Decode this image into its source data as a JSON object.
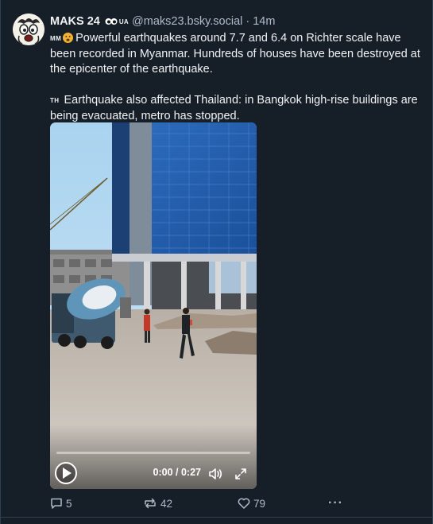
{
  "post": {
    "author_name": "MAKS 24",
    "badge_code": "UA",
    "handle": "@maks23.bsky.social",
    "separator": "·",
    "time": "14m",
    "p1_flag": "MM",
    "p1_text": "Powerful earthquakes around 7.7 and 6.4 on Richter scale have been recorded in Myanmar. Hundreds of houses have been destroyed at the epicenter of the earthquake.",
    "p2_flag": "TH",
    "p2_text": "Earthquake also affected Thailand: in Bangkok high-rise buildings are being evacuated, metro has stopped."
  },
  "video": {
    "timecode": "0:00 / 0:27",
    "progress": 0
  },
  "actions": {
    "replies": "5",
    "reposts": "42",
    "likes": "79",
    "more": "···"
  },
  "icons": {
    "avatar": "cartoon-face-avatar",
    "badge": "eyes-icon",
    "emoji": "anxious-face-emoji",
    "play": "play-icon",
    "volume": "volume-icon",
    "fullscreen": "fullscreen-icon",
    "reply": "reply-icon",
    "repost": "repost-icon",
    "like": "heart-icon",
    "more": "more-icon"
  },
  "colors": {
    "background": "#161e27",
    "text": "#f1f3f5",
    "muted": "#aebbc9",
    "border": "#2e4052"
  }
}
